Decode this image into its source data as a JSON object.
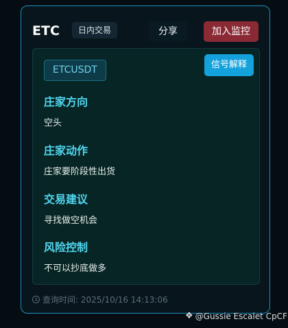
{
  "header": {
    "symbol": "ETC",
    "mode": "日内交易",
    "share_label": "分享",
    "monitor_label": "加入监控"
  },
  "panel": {
    "pair": "ETCUSDT",
    "explain_label": "信号解释",
    "sections": [
      {
        "title": "庄家方向",
        "body": "空头"
      },
      {
        "title": "庄家动作",
        "body": "庄家要阶段性出货"
      },
      {
        "title": "交易建议",
        "body": "寻找做空机会"
      },
      {
        "title": "风险控制",
        "body": "不可以抄底做多"
      }
    ]
  },
  "footer": {
    "query_time": "查询时间: 2025/10/16 14:13:06"
  },
  "watermark": {
    "text": "@Gussie Escalet CpCF",
    "icon": "binance-diamond-icon"
  }
}
